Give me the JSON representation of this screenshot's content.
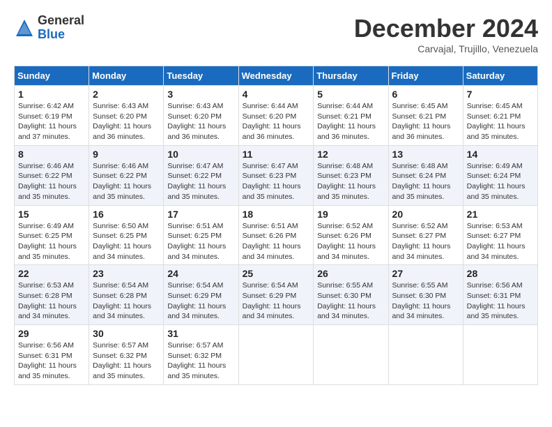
{
  "header": {
    "logo": {
      "general": "General",
      "blue": "Blue"
    },
    "title": "December 2024",
    "location": "Carvajal, Trujillo, Venezuela"
  },
  "calendar": {
    "days_of_week": [
      "Sunday",
      "Monday",
      "Tuesday",
      "Wednesday",
      "Thursday",
      "Friday",
      "Saturday"
    ],
    "weeks": [
      [
        null,
        {
          "day": "2",
          "sunrise": "6:43 AM",
          "sunset": "6:20 PM",
          "daylight": "11 hours and 36 minutes."
        },
        {
          "day": "3",
          "sunrise": "6:43 AM",
          "sunset": "6:20 PM",
          "daylight": "11 hours and 36 minutes."
        },
        {
          "day": "4",
          "sunrise": "6:44 AM",
          "sunset": "6:20 PM",
          "daylight": "11 hours and 36 minutes."
        },
        {
          "day": "5",
          "sunrise": "6:44 AM",
          "sunset": "6:21 PM",
          "daylight": "11 hours and 36 minutes."
        },
        {
          "day": "6",
          "sunrise": "6:45 AM",
          "sunset": "6:21 PM",
          "daylight": "11 hours and 36 minutes."
        },
        {
          "day": "7",
          "sunrise": "6:45 AM",
          "sunset": "6:21 PM",
          "daylight": "11 hours and 35 minutes."
        }
      ],
      [
        {
          "day": "1",
          "sunrise": "6:42 AM",
          "sunset": "6:19 PM",
          "daylight": "11 hours and 37 minutes."
        },
        {
          "day": "9",
          "sunrise": "6:46 AM",
          "sunset": "6:22 PM",
          "daylight": "11 hours and 35 minutes."
        },
        {
          "day": "10",
          "sunrise": "6:47 AM",
          "sunset": "6:22 PM",
          "daylight": "11 hours and 35 minutes."
        },
        {
          "day": "11",
          "sunrise": "6:47 AM",
          "sunset": "6:23 PM",
          "daylight": "11 hours and 35 minutes."
        },
        {
          "day": "12",
          "sunrise": "6:48 AM",
          "sunset": "6:23 PM",
          "daylight": "11 hours and 35 minutes."
        },
        {
          "day": "13",
          "sunrise": "6:48 AM",
          "sunset": "6:24 PM",
          "daylight": "11 hours and 35 minutes."
        },
        {
          "day": "14",
          "sunrise": "6:49 AM",
          "sunset": "6:24 PM",
          "daylight": "11 hours and 35 minutes."
        }
      ],
      [
        {
          "day": "8",
          "sunrise": "6:46 AM",
          "sunset": "6:22 PM",
          "daylight": "11 hours and 35 minutes."
        },
        {
          "day": "16",
          "sunrise": "6:50 AM",
          "sunset": "6:25 PM",
          "daylight": "11 hours and 34 minutes."
        },
        {
          "day": "17",
          "sunrise": "6:51 AM",
          "sunset": "6:25 PM",
          "daylight": "11 hours and 34 minutes."
        },
        {
          "day": "18",
          "sunrise": "6:51 AM",
          "sunset": "6:26 PM",
          "daylight": "11 hours and 34 minutes."
        },
        {
          "day": "19",
          "sunrise": "6:52 AM",
          "sunset": "6:26 PM",
          "daylight": "11 hours and 34 minutes."
        },
        {
          "day": "20",
          "sunrise": "6:52 AM",
          "sunset": "6:27 PM",
          "daylight": "11 hours and 34 minutes."
        },
        {
          "day": "21",
          "sunrise": "6:53 AM",
          "sunset": "6:27 PM",
          "daylight": "11 hours and 34 minutes."
        }
      ],
      [
        {
          "day": "15",
          "sunrise": "6:49 AM",
          "sunset": "6:25 PM",
          "daylight": "11 hours and 35 minutes."
        },
        {
          "day": "23",
          "sunrise": "6:54 AM",
          "sunset": "6:28 PM",
          "daylight": "11 hours and 34 minutes."
        },
        {
          "day": "24",
          "sunrise": "6:54 AM",
          "sunset": "6:29 PM",
          "daylight": "11 hours and 34 minutes."
        },
        {
          "day": "25",
          "sunrise": "6:54 AM",
          "sunset": "6:29 PM",
          "daylight": "11 hours and 34 minutes."
        },
        {
          "day": "26",
          "sunrise": "6:55 AM",
          "sunset": "6:30 PM",
          "daylight": "11 hours and 34 minutes."
        },
        {
          "day": "27",
          "sunrise": "6:55 AM",
          "sunset": "6:30 PM",
          "daylight": "11 hours and 34 minutes."
        },
        {
          "day": "28",
          "sunrise": "6:56 AM",
          "sunset": "6:31 PM",
          "daylight": "11 hours and 35 minutes."
        }
      ],
      [
        {
          "day": "22",
          "sunrise": "6:53 AM",
          "sunset": "6:28 PM",
          "daylight": "11 hours and 34 minutes."
        },
        {
          "day": "30",
          "sunrise": "6:57 AM",
          "sunset": "6:32 PM",
          "daylight": "11 hours and 35 minutes."
        },
        {
          "day": "31",
          "sunrise": "6:57 AM",
          "sunset": "6:32 PM",
          "daylight": "11 hours and 35 minutes."
        },
        null,
        null,
        null,
        null
      ],
      [
        {
          "day": "29",
          "sunrise": "6:56 AM",
          "sunset": "6:31 PM",
          "daylight": "11 hours and 35 minutes."
        },
        null,
        null,
        null,
        null,
        null,
        null
      ]
    ],
    "row_order": [
      [
        {
          "day": "1",
          "sunrise": "6:42 AM",
          "sunset": "6:19 PM",
          "daylight": "11 hours and 37 minutes."
        },
        {
          "day": "2",
          "sunrise": "6:43 AM",
          "sunset": "6:20 PM",
          "daylight": "11 hours and 36 minutes."
        },
        {
          "day": "3",
          "sunrise": "6:43 AM",
          "sunset": "6:20 PM",
          "daylight": "11 hours and 36 minutes."
        },
        {
          "day": "4",
          "sunrise": "6:44 AM",
          "sunset": "6:20 PM",
          "daylight": "11 hours and 36 minutes."
        },
        {
          "day": "5",
          "sunrise": "6:44 AM",
          "sunset": "6:21 PM",
          "daylight": "11 hours and 36 minutes."
        },
        {
          "day": "6",
          "sunrise": "6:45 AM",
          "sunset": "6:21 PM",
          "daylight": "11 hours and 36 minutes."
        },
        {
          "day": "7",
          "sunrise": "6:45 AM",
          "sunset": "6:21 PM",
          "daylight": "11 hours and 35 minutes."
        }
      ],
      [
        {
          "day": "8",
          "sunrise": "6:46 AM",
          "sunset": "6:22 PM",
          "daylight": "11 hours and 35 minutes."
        },
        {
          "day": "9",
          "sunrise": "6:46 AM",
          "sunset": "6:22 PM",
          "daylight": "11 hours and 35 minutes."
        },
        {
          "day": "10",
          "sunrise": "6:47 AM",
          "sunset": "6:22 PM",
          "daylight": "11 hours and 35 minutes."
        },
        {
          "day": "11",
          "sunrise": "6:47 AM",
          "sunset": "6:23 PM",
          "daylight": "11 hours and 35 minutes."
        },
        {
          "day": "12",
          "sunrise": "6:48 AM",
          "sunset": "6:23 PM",
          "daylight": "11 hours and 35 minutes."
        },
        {
          "day": "13",
          "sunrise": "6:48 AM",
          "sunset": "6:24 PM",
          "daylight": "11 hours and 35 minutes."
        },
        {
          "day": "14",
          "sunrise": "6:49 AM",
          "sunset": "6:24 PM",
          "daylight": "11 hours and 35 minutes."
        }
      ],
      [
        {
          "day": "15",
          "sunrise": "6:49 AM",
          "sunset": "6:25 PM",
          "daylight": "11 hours and 35 minutes."
        },
        {
          "day": "16",
          "sunrise": "6:50 AM",
          "sunset": "6:25 PM",
          "daylight": "11 hours and 34 minutes."
        },
        {
          "day": "17",
          "sunrise": "6:51 AM",
          "sunset": "6:25 PM",
          "daylight": "11 hours and 34 minutes."
        },
        {
          "day": "18",
          "sunrise": "6:51 AM",
          "sunset": "6:26 PM",
          "daylight": "11 hours and 34 minutes."
        },
        {
          "day": "19",
          "sunrise": "6:52 AM",
          "sunset": "6:26 PM",
          "daylight": "11 hours and 34 minutes."
        },
        {
          "day": "20",
          "sunrise": "6:52 AM",
          "sunset": "6:27 PM",
          "daylight": "11 hours and 34 minutes."
        },
        {
          "day": "21",
          "sunrise": "6:53 AM",
          "sunset": "6:27 PM",
          "daylight": "11 hours and 34 minutes."
        }
      ],
      [
        {
          "day": "22",
          "sunrise": "6:53 AM",
          "sunset": "6:28 PM",
          "daylight": "11 hours and 34 minutes."
        },
        {
          "day": "23",
          "sunrise": "6:54 AM",
          "sunset": "6:28 PM",
          "daylight": "11 hours and 34 minutes."
        },
        {
          "day": "24",
          "sunrise": "6:54 AM",
          "sunset": "6:29 PM",
          "daylight": "11 hours and 34 minutes."
        },
        {
          "day": "25",
          "sunrise": "6:54 AM",
          "sunset": "6:29 PM",
          "daylight": "11 hours and 34 minutes."
        },
        {
          "day": "26",
          "sunrise": "6:55 AM",
          "sunset": "6:30 PM",
          "daylight": "11 hours and 34 minutes."
        },
        {
          "day": "27",
          "sunrise": "6:55 AM",
          "sunset": "6:30 PM",
          "daylight": "11 hours and 34 minutes."
        },
        {
          "day": "28",
          "sunrise": "6:56 AM",
          "sunset": "6:31 PM",
          "daylight": "11 hours and 35 minutes."
        }
      ],
      [
        {
          "day": "29",
          "sunrise": "6:56 AM",
          "sunset": "6:31 PM",
          "daylight": "11 hours and 35 minutes."
        },
        {
          "day": "30",
          "sunrise": "6:57 AM",
          "sunset": "6:32 PM",
          "daylight": "11 hours and 35 minutes."
        },
        {
          "day": "31",
          "sunrise": "6:57 AM",
          "sunset": "6:32 PM",
          "daylight": "11 hours and 35 minutes."
        },
        null,
        null,
        null,
        null
      ]
    ]
  }
}
